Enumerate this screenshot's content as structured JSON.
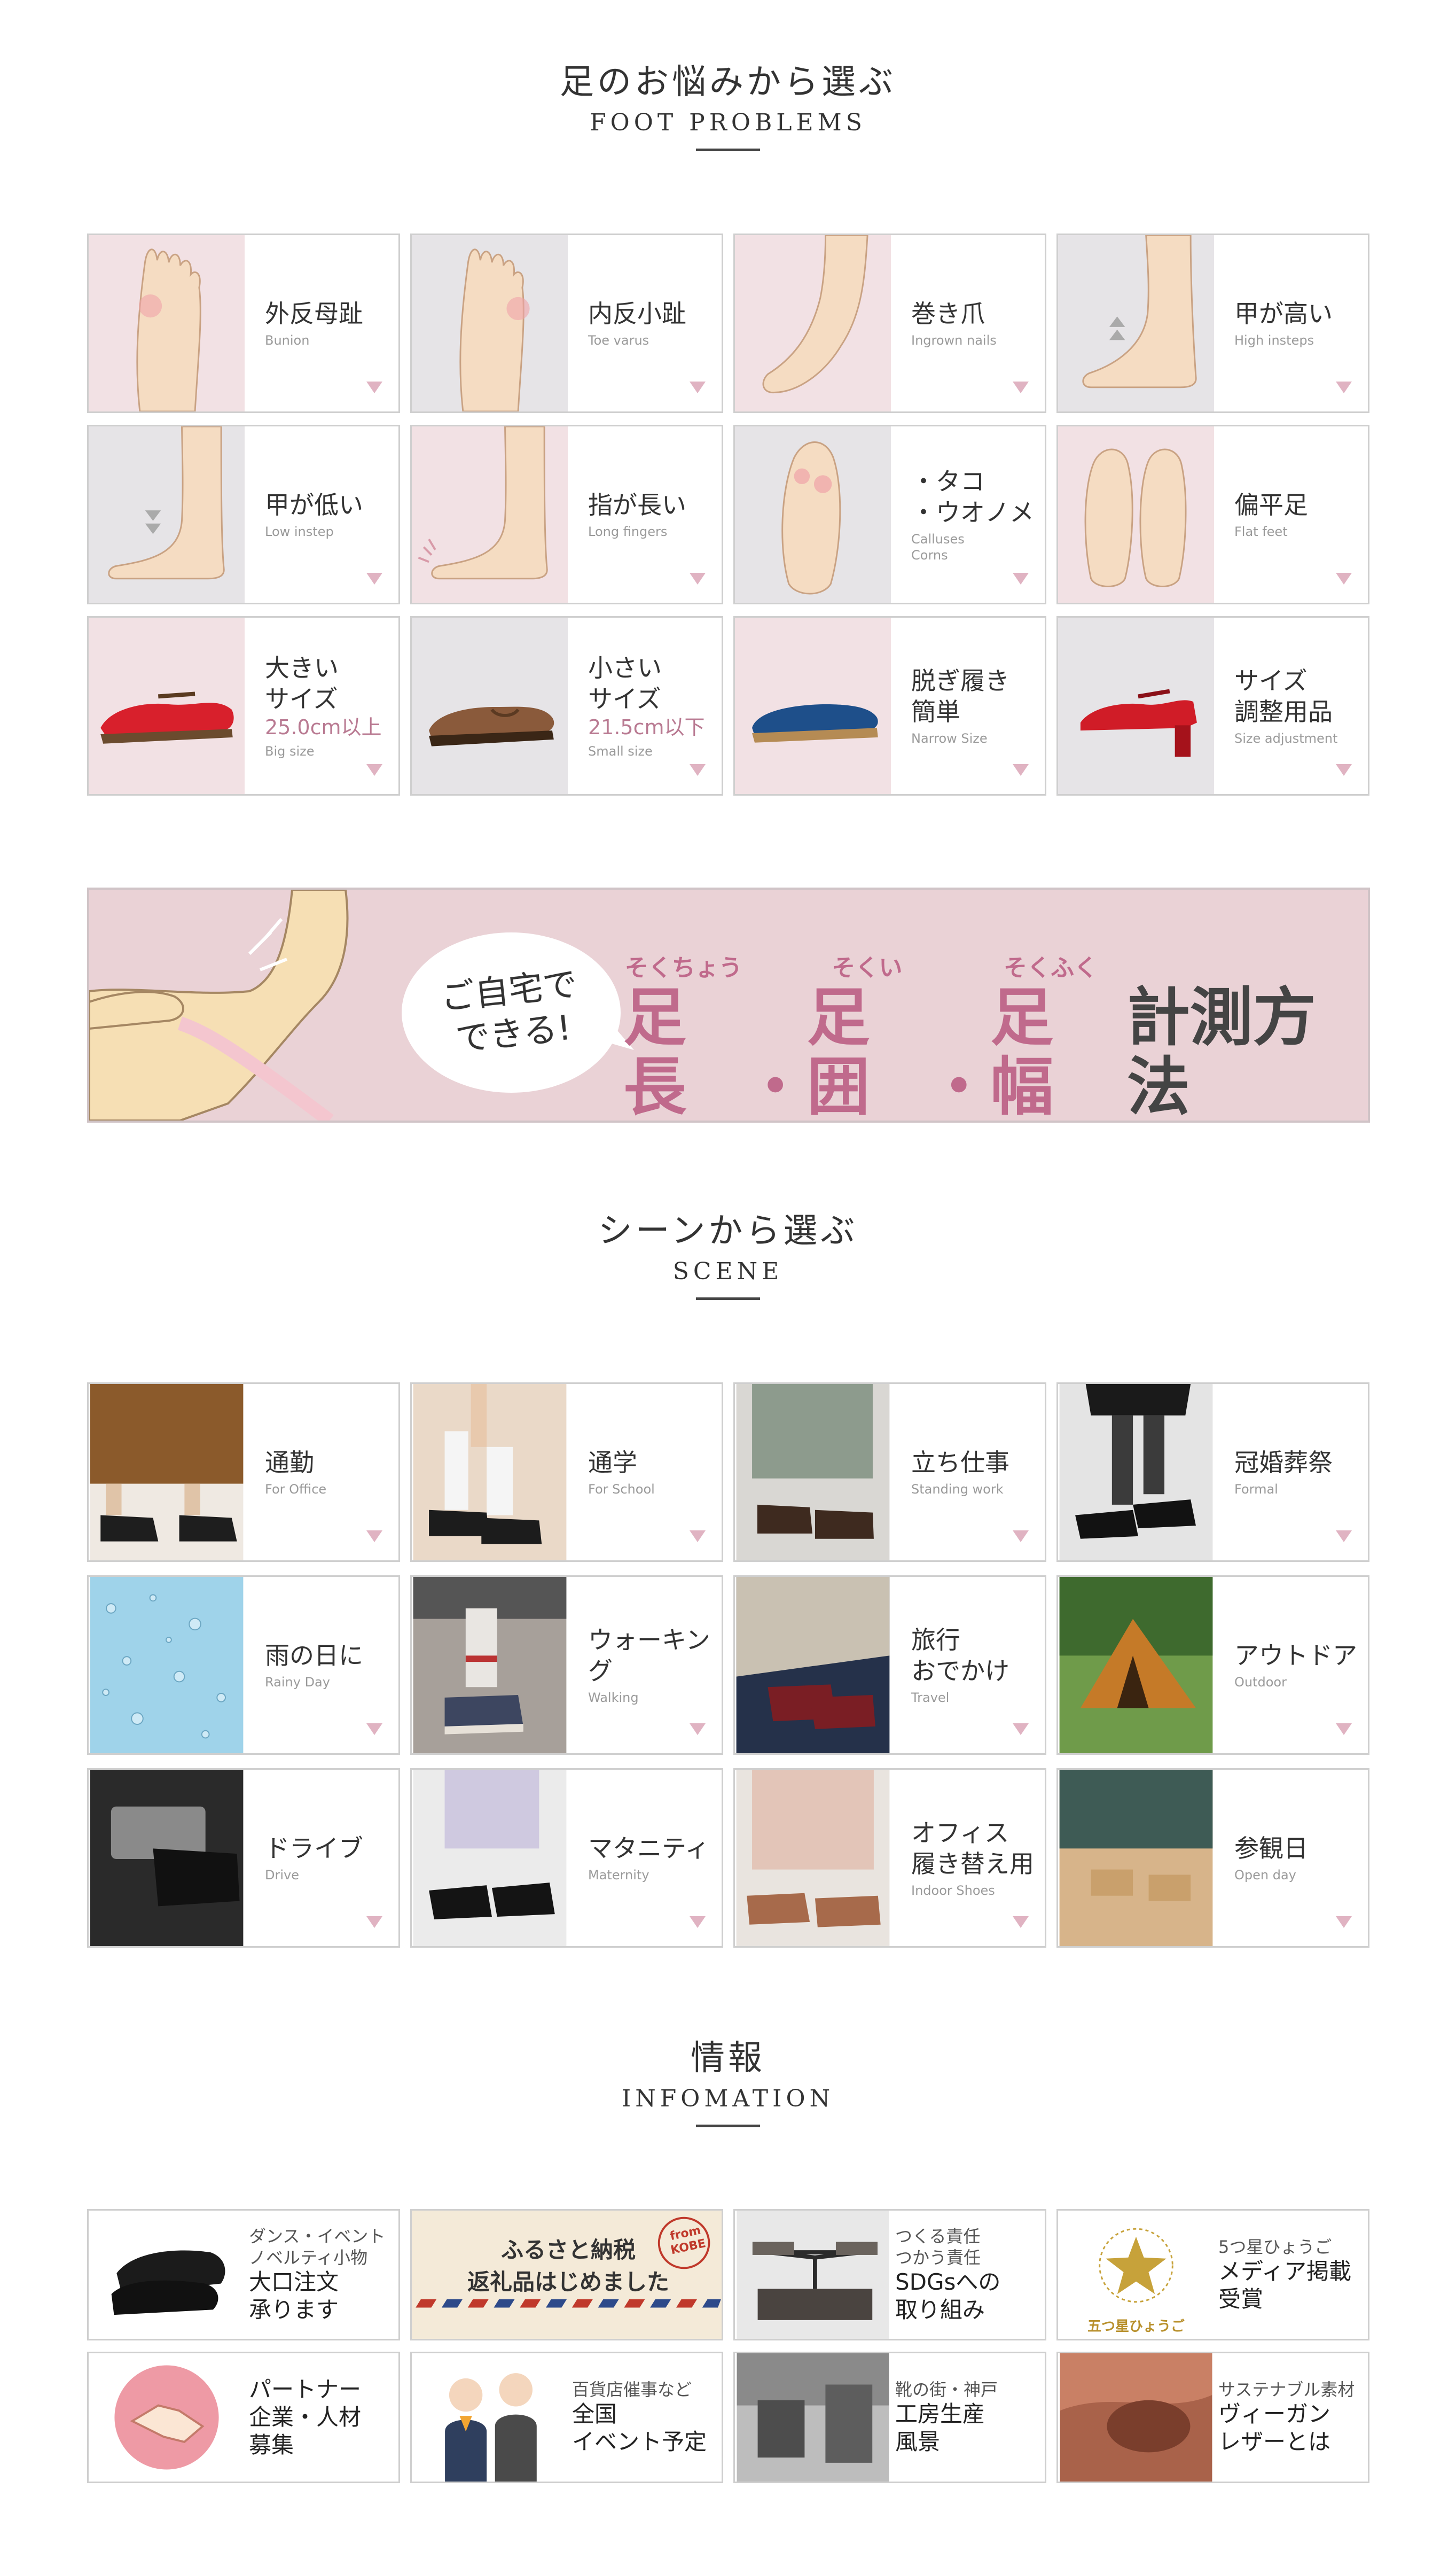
{
  "foot_problems": {
    "title": "足のお悩みから選ぶ",
    "subtitle": "FOOT PROBLEMS",
    "items": [
      {
        "jp": "外反母趾",
        "en": "Bunion"
      },
      {
        "jp": "内反小趾",
        "en": "Toe varus"
      },
      {
        "jp": "巻き爪",
        "en": "Ingrown nails"
      },
      {
        "jp": "甲が高い",
        "en": "High insteps"
      },
      {
        "jp": "甲が低い",
        "en": "Low instep"
      },
      {
        "jp": "指が長い",
        "en": "Long fingers"
      },
      {
        "jp": "・タコ\n・ウオノメ",
        "en": "Calluses\nCorns"
      },
      {
        "jp": "偏平足",
        "en": "Flat feet"
      },
      {
        "jp": "大きい\nサイズ",
        "jp2": "25.0cm以上",
        "en": "Big size"
      },
      {
        "jp": "小さい\nサイズ",
        "jp2": "21.5cm以下",
        "en": "Small size"
      },
      {
        "jp": "脱ぎ履き\n簡単",
        "en": "Narrow Size"
      },
      {
        "jp": "サイズ\n調整用品",
        "en": "Size adjustment"
      }
    ]
  },
  "banner": {
    "bubble": "ご自宅で\nできる!",
    "ruby1": "そくちょう",
    "ruby2": "そくい",
    "ruby3": "そくふく",
    "word1": "足長",
    "word2": "足囲",
    "word3": "足幅",
    "dot": "・",
    "tail": "計測方法"
  },
  "scene": {
    "title": "シーンから選ぶ",
    "subtitle": "SCENE",
    "items": [
      {
        "jp": "通勤",
        "en": "For Office"
      },
      {
        "jp": "通学",
        "en": "For School"
      },
      {
        "jp": "立ち仕事",
        "en": "Standing work"
      },
      {
        "jp": "冠婚葬祭",
        "en": "Formal"
      },
      {
        "jp": "雨の日に",
        "en": "Rainy Day"
      },
      {
        "jp": "ウォーキング",
        "en": "Walking"
      },
      {
        "jp": "旅行\nおでかけ",
        "en": "Travel"
      },
      {
        "jp": "アウトドア",
        "en": "Outdoor"
      },
      {
        "jp": "ドライブ",
        "en": "Drive"
      },
      {
        "jp": "マタニティ",
        "en": "Maternity"
      },
      {
        "jp": "オフィス\n履き替え用",
        "en": "Indoor Shoes"
      },
      {
        "jp": "参観日",
        "en": "Open day"
      }
    ]
  },
  "info": {
    "title": "情報",
    "subtitle": "INFOMATION",
    "items": [
      {
        "small": "ダンス・イベント\nノベルティ小物",
        "big": "大口注文\n承ります"
      },
      {
        "line1": "ふるさと納税",
        "line2": "返礼品はじめました",
        "stamp": "from\nKOBE"
      },
      {
        "small": "つくる責任\nつかう責任",
        "big": "SDGsへの\n取り組み"
      },
      {
        "small": "5つ星ひょうご",
        "big": "メディア掲載\n受賞",
        "logo_text": "五つ星ひょうご"
      },
      {
        "small": "",
        "big": "パートナー\n企業・人材\n募集"
      },
      {
        "small": "百貨店催事など",
        "big": "全国\nイベント予定"
      },
      {
        "small": "靴の街・神戸",
        "big": "工房生産\n風景"
      },
      {
        "small": "サステナブル素材",
        "big": "ヴィーガン\nレザーとは"
      }
    ]
  },
  "colors": {
    "pink_bg": "#f2e1e4",
    "gray_bg": "#e6e4e7",
    "accent": "#c06a8c",
    "arrow": "#e0b3c2"
  }
}
